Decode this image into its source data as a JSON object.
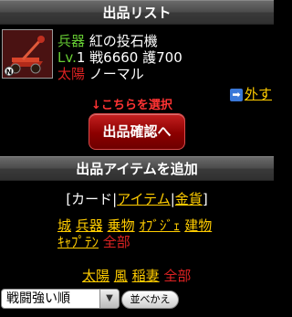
{
  "header": {
    "title": "出品リスト"
  },
  "item": {
    "type": "兵器",
    "name": "紅の投石機",
    "level_label": "Lv.",
    "level": "1",
    "attack": "戦6660",
    "defense": "護700",
    "element": "太陽",
    "rarity": "ノーマル",
    "badge": "N"
  },
  "remove_link": "外す",
  "pointer_text": "↓こちらを選択",
  "confirm_button": "出品確認へ",
  "section2": {
    "title": "出品アイテムを追加"
  },
  "categories": {
    "open": "[カード|",
    "item": "アイテム",
    "sep": "|",
    "gold": "金貨",
    "close": "]"
  },
  "types": [
    "城",
    "兵器",
    "乗物",
    "ｵﾌﾞｼﾞｪ",
    "建物",
    "ｷｬﾌﾟﾃﾝ"
  ],
  "types_all": "全部",
  "elements": [
    "太陽",
    "風",
    "稲妻"
  ],
  "elements_all": "全部",
  "sort": {
    "selected": "戦闘強い順",
    "button": "並べかえ"
  },
  "colors": {
    "accent_red": "#dd2222",
    "link_yellow": "#ffcc00",
    "green": "#66cc33"
  }
}
